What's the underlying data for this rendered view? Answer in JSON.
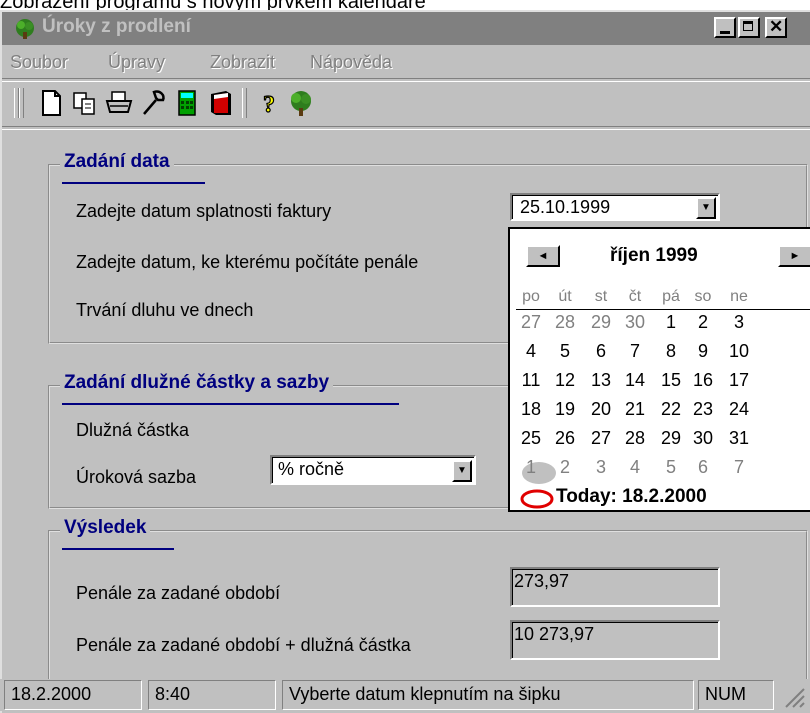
{
  "caption": "Zobrazení programu s novým prvkem kalendáře",
  "window": {
    "title": "Úroky z prodlení"
  },
  "menu": [
    {
      "label": "Soubor"
    },
    {
      "label": "Úpravy"
    },
    {
      "label": "Zobrazit"
    },
    {
      "label": "Nápověda"
    }
  ],
  "toolbar": {
    "icons": [
      "new-document-icon",
      "copy-icon",
      "print-icon",
      "tools-icon",
      "calculator-icon",
      "book-icon",
      "help-icon",
      "about-icon"
    ]
  },
  "date_section": {
    "title": "Zadání data",
    "due_date_label": "Zadejte datum splatnosti faktury",
    "due_date_value": "25.10.1999",
    "calc_date_label": "Zadejte datum, ke kterému počítáte penále",
    "duration_label": "Trvání dluhu ve dnech"
  },
  "amount_section": {
    "title": "Zadání dlužné částky a sazby",
    "amount_label": "Dlužná částka",
    "rate_label": "Úroková sazba",
    "rate_unit_value": "% ročně"
  },
  "result_section": {
    "title": "Výsledek",
    "penalty_label": "Penále za zadané období",
    "penalty_value": "273,97",
    "total_label": "Penále za zadané období + dlužná částka",
    "total_value": "10 273,97"
  },
  "calendar": {
    "month": "říjen 1999",
    "prev_symbol": "◄",
    "next_symbol": "►",
    "weekdays": [
      "po",
      "út",
      "st",
      "čt",
      "pá",
      "so",
      "ne"
    ],
    "weeks": [
      [
        "27",
        "28",
        "29",
        "30",
        "1",
        "2",
        "3"
      ],
      [
        "4",
        "5",
        "6",
        "7",
        "8",
        "9",
        "10"
      ],
      [
        "11",
        "12",
        "13",
        "14",
        "15",
        "16",
        "17"
      ],
      [
        "18",
        "19",
        "20",
        "21",
        "22",
        "23",
        "24"
      ],
      [
        "25",
        "26",
        "27",
        "28",
        "29",
        "30",
        "31"
      ],
      [
        "1",
        "2",
        "3",
        "4",
        "5",
        "6",
        "7"
      ]
    ],
    "selected_day": "25",
    "today_label": "Today: 18.2.2000"
  },
  "status": {
    "date": "18.2.2000",
    "time": "8:40",
    "message": "Vyberte datum klepnutím na šipku",
    "num": "NUM"
  }
}
